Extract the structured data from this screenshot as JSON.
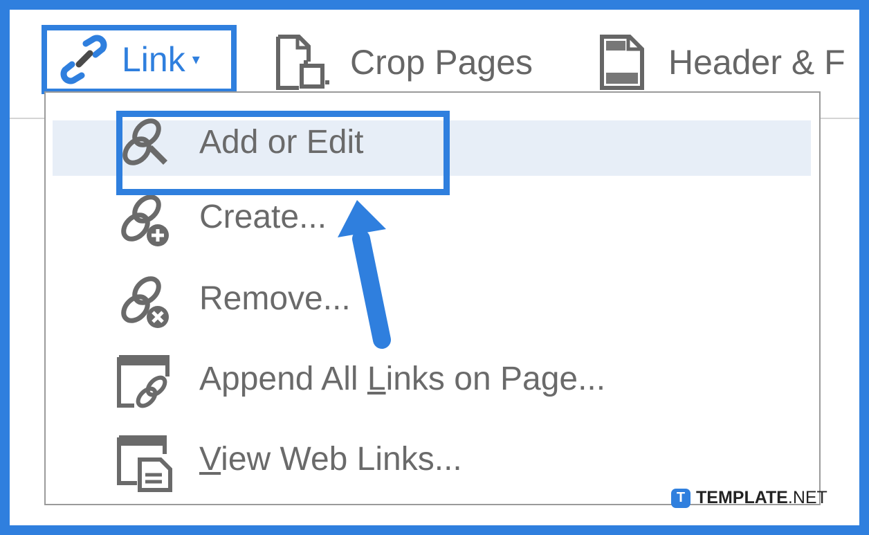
{
  "toolbar": {
    "link_label": "Link",
    "link_caret": "▾",
    "crop_label": "Crop Pages",
    "header_label": "Header & F"
  },
  "menu": {
    "items": [
      {
        "label": "Add or Edit",
        "icon": "link-edit-icon"
      },
      {
        "label": "Create...",
        "icon": "link-add-icon"
      },
      {
        "label": "Remove...",
        "icon": "link-remove-icon"
      },
      {
        "label_pre": "Append All ",
        "label_underlined": "L",
        "label_post": "inks on Page...",
        "icon": "append-links-icon"
      },
      {
        "label_pre": "",
        "label_underlined": "V",
        "label_post": "iew Web Links...",
        "icon": "web-links-icon"
      }
    ]
  },
  "watermark": {
    "logo_letter": "T",
    "brand": "TEMPLATE",
    "suffix": ".NET"
  },
  "colors": {
    "accent": "#2f7fde",
    "highlight_bg": "#e7eef7",
    "text_gray": "#6a6a6a"
  }
}
